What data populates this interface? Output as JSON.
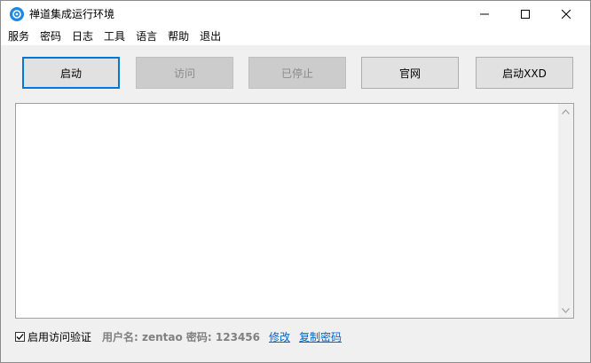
{
  "window": {
    "title": "禅道集成运行环境",
    "app_icon": "zentao-logo-icon",
    "controls": [
      "minimize-icon",
      "maximize-icon",
      "close-icon"
    ]
  },
  "menu": {
    "items": [
      "服务",
      "密码",
      "日志",
      "工具",
      "语言",
      "帮助",
      "退出"
    ]
  },
  "buttons": {
    "start": "启动",
    "visit": "访问",
    "stopped": "已停止",
    "website": "官网",
    "start_xxd": "启动XXD"
  },
  "log": {
    "content": ""
  },
  "footer": {
    "checkbox_label": "启用访问验证",
    "checkbox_checked": true,
    "credentials": "用户名: zentao 密码: 123456",
    "edit_link": "修改",
    "copy_link": "复制密码"
  },
  "colors": {
    "accent": "#0078d7",
    "link": "#0066cc",
    "disabled_text": "#8a8a8a"
  }
}
